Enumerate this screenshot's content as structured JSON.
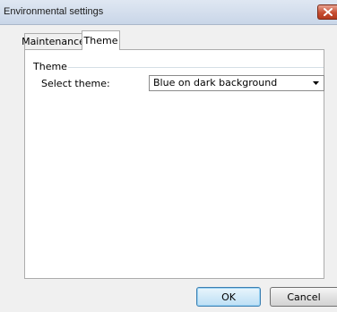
{
  "window": {
    "title": "Environmental settings"
  },
  "tabs": [
    {
      "label": "Maintenance",
      "selected": false
    },
    {
      "label": "Theme",
      "selected": true
    }
  ],
  "theme_group": {
    "title": "Theme",
    "select_label": "Select theme:",
    "selected_value": "Blue on dark background"
  },
  "buttons": {
    "ok": "OK",
    "cancel": "Cancel"
  },
  "colors": {
    "close_button": "#c74e32",
    "default_button_border": "#3c7fb1",
    "panel_background": "#ffffff",
    "window_background": "#f0f0f0"
  },
  "icons": {
    "close": "close-icon",
    "dropdown": "chevron-down-icon"
  }
}
